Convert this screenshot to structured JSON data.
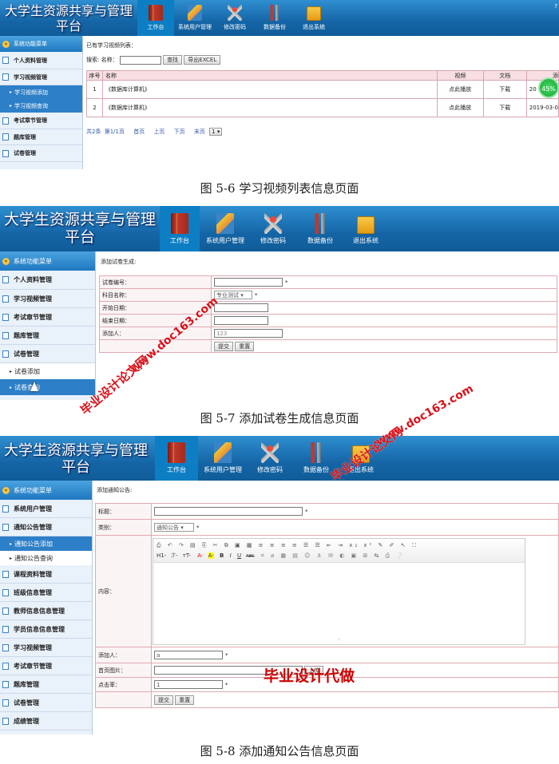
{
  "app_title_line1": "大学生资源共享与管理",
  "app_title_line2": "平台",
  "nav": [
    "工作台",
    "系统用户管理",
    "修改密码",
    "数据备份",
    "退出系统"
  ],
  "help": "? ",
  "menu_header": "系统功能菜单",
  "captions": [
    "图 5-6 学习视频列表信息页面",
    "图 5-7 添加试卷生成信息页面",
    "图 5-8 添加通知公告信息页面"
  ],
  "s1": {
    "menu": [
      "个人资料管理",
      "学习视频管理",
      "学习视频添加",
      "学习视频查询",
      "考试章节管理",
      "题库管理",
      "试卷管理"
    ],
    "title": "已有学习视频列表：",
    "search_label": "搜索: 名称：",
    "search_btn": "查找",
    "export_btn": "导出EXCEL",
    "columns": [
      "序号",
      "名称",
      "视频",
      "文档",
      "添"
    ],
    "rows": [
      [
        "1",
        "《数据库计算机》",
        "点此播放",
        "下载",
        "20"
      ],
      [
        "2",
        "《数据库计算机》",
        "点此播放",
        "下载",
        "2019-03-0"
      ]
    ],
    "pager": [
      "共2条",
      "第1/1页",
      "首页",
      "上页",
      "下页",
      "末页"
    ],
    "pager_select": "1 ▾",
    "badge": "45%"
  },
  "s2": {
    "menu": [
      "个人资料管理",
      "学习视频管理",
      "考试章节管理",
      "题库管理",
      "试卷管理",
      "试卷添加",
      "试卷查询"
    ],
    "title": "添加试卷生成:",
    "fields": [
      "试卷编号：",
      "科目名称：",
      "开始日期：",
      "结束日期：",
      "添加人："
    ],
    "subject_value": "专业测试 ▾",
    "adder_value": "123",
    "submit": "提交",
    "reset": "重置"
  },
  "s3": {
    "menu": [
      "系统用户管理",
      "通知公告管理",
      "通知公告添加",
      "通知公告查询",
      "课程资料管理",
      "班级信息管理",
      "教师信息信息管理",
      "学员信息信息管理",
      "学习视频管理",
      "考试章节管理",
      "题库管理",
      "试卷管理",
      "成绩管理"
    ],
    "title": "添加通知公告:",
    "fields": [
      "标题：",
      "类别：",
      "内容：",
      "添加人：",
      "首页图片：",
      "点击率："
    ],
    "category_value": "通知公告 ▾",
    "adder_value": "a",
    "clicks_value": "1",
    "upload_btn": "上传",
    "submit": "提交",
    "reset": "重置",
    "editor_row2": [
      "H1-",
      "ℱ-",
      "тT-",
      "A-",
      "A-",
      "B",
      "I",
      "U",
      "ABC"
    ]
  },
  "watermarks": [
    "毕业设计论文网",
    "www.doc163.com",
    "毕业设计论文网",
    "www.doc163.com",
    "毕业设计代做"
  ]
}
